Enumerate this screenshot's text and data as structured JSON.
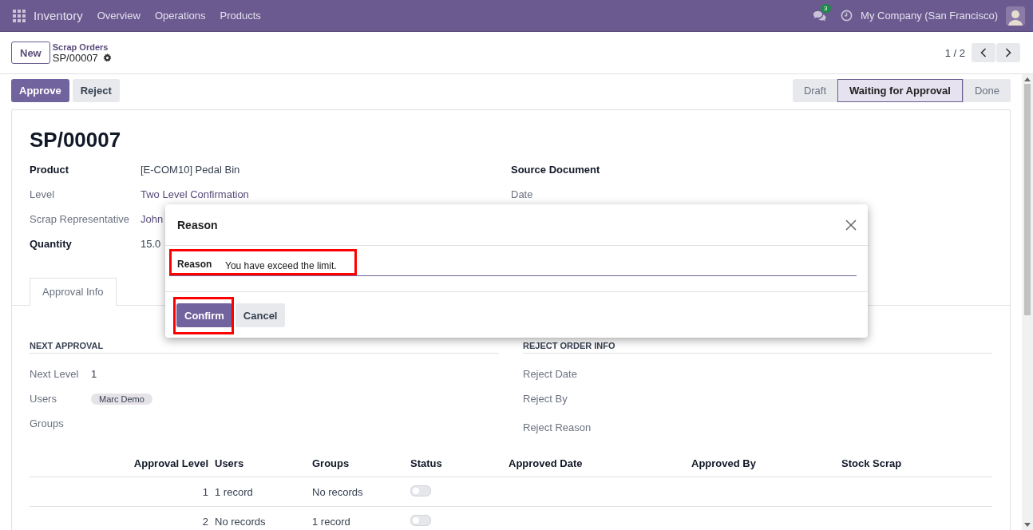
{
  "topbar": {
    "app": "Inventory",
    "menu": [
      "Overview",
      "Operations",
      "Products"
    ],
    "chat_count": "3",
    "company": "My Company (San Francisco)"
  },
  "control_panel": {
    "new_button": "New",
    "breadcrumb": "Scrap Orders",
    "record": "SP/00007",
    "pager": "1 / 2"
  },
  "actions": [
    {
      "label": "Approve",
      "kind": "primary"
    },
    {
      "label": "Reject",
      "kind": "secondary"
    }
  ],
  "statusbar": [
    {
      "label": "Draft",
      "selected": false
    },
    {
      "label": "Waiting for Approval",
      "selected": true
    },
    {
      "label": "Done",
      "selected": false
    }
  ],
  "sheet": {
    "title": "SP/00007",
    "left_fields": [
      {
        "label": "Product",
        "value": "[E-COM10] Pedal Bin",
        "bold": true,
        "link": false
      },
      {
        "label": "Level",
        "value": "Two Level Confirmation",
        "bold": false,
        "link": true
      },
      {
        "label": "Scrap Representative",
        "value": "John",
        "bold": false,
        "link": true
      },
      {
        "label": "Quantity",
        "value": "15.0",
        "bold": true,
        "link": false
      }
    ],
    "right_fields": [
      {
        "label": "Source Document",
        "bold": true
      },
      {
        "label": "Date",
        "bold": false
      }
    ],
    "tabs": [
      {
        "label": "Approval Info",
        "selected": true
      }
    ],
    "next_approval": {
      "title": "NEXT APPROVAL",
      "next_level_label": "Next Level",
      "next_level": "1",
      "users_label": "Users",
      "users_tag": "Marc Demo",
      "groups_label": "Groups"
    },
    "reject_info": {
      "title": "REJECT ORDER INFO",
      "fields": [
        "Reject Date",
        "Reject By",
        "Reject Reason"
      ]
    },
    "table": {
      "columns": [
        "Approval Level",
        "Users",
        "Groups",
        "Status",
        "Approved Date",
        "Approved By",
        "Stock Scrap"
      ],
      "rows": [
        {
          "level": "1",
          "users": "1 record",
          "groups": "No records",
          "checked": false
        },
        {
          "level": "2",
          "users": "No records",
          "groups": "1 record",
          "checked": false
        }
      ]
    }
  },
  "dialog": {
    "title": "Reason",
    "field_label": "Reason",
    "value": "You have exceed the limit.",
    "buttons": [
      {
        "label": "Confirm",
        "kind": "primary"
      },
      {
        "label": "Cancel",
        "kind": "secondary"
      }
    ]
  }
}
